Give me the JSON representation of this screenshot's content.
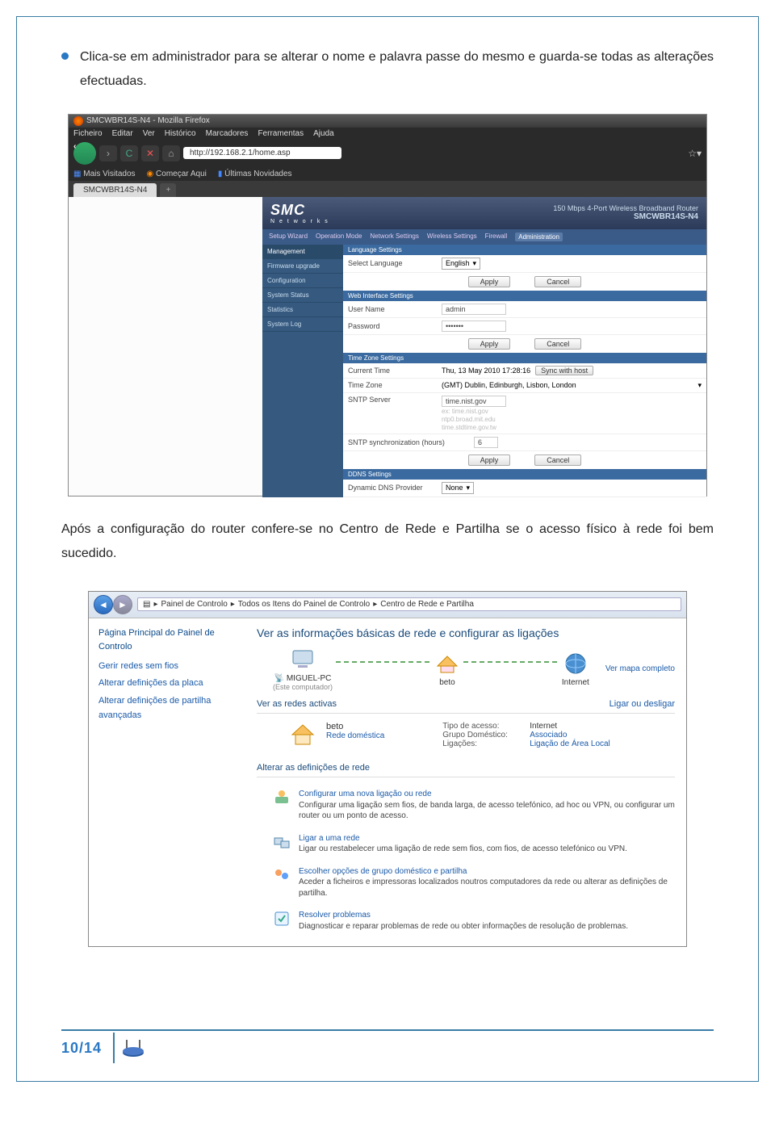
{
  "para1": "Clica-se em administrador para se alterar o nome e palavra passe do mesmo e guarda-se todas as alterações efectuadas.",
  "para2": "Após a configuração do router confere-se no Centro de Rede e Partilha se o acesso físico à rede foi bem sucedido.",
  "page_number": "10/14",
  "firefox": {
    "title": "SMCWBR14S-N4 - Mozilla Firefox",
    "menu": [
      "Ficheiro",
      "Editar",
      "Ver",
      "Histórico",
      "Marcadores",
      "Ferramentas",
      "Ajuda"
    ],
    "url": "http://192.168.2.1/home.asp",
    "bookmarks": [
      "Mais Visitados",
      "Começar Aqui",
      "Últimas Novidades"
    ],
    "tab": "SMCWBR14S-N4"
  },
  "router": {
    "brand": "SMC",
    "brand_sub": "N e t w o r k s",
    "product_title": "150 Mbps 4-Port Wireless Broadband Router",
    "model": "SMCWBR14S-N4",
    "top_tabs": [
      "Setup Wizard",
      "Operation Mode",
      "Network Settings",
      "Wireless Settings",
      "Firewall",
      "Administration"
    ],
    "side": [
      "Management",
      "Firmware upgrade",
      "Configuration",
      "System Status",
      "Statistics",
      "System Log"
    ],
    "lang_hdr": "Language Settings",
    "lang_lbl": "Select Language",
    "lang_val": "English",
    "apply": "Apply",
    "cancel": "Cancel",
    "web_hdr": "Web Interface Settings",
    "user_lbl": "User Name",
    "user_val": "admin",
    "pass_lbl": "Password",
    "pass_val": "•••••••",
    "tz_hdr": "Time Zone Settings",
    "ct_lbl": "Current Time",
    "ct_val": "Thu, 13 May 2010 17:28:16",
    "sync_btn": "Sync with host",
    "tz_lbl": "Time Zone",
    "tz_val": "(GMT) Dublin, Edinburgh, Lisbon, London",
    "sntp_lbl": "SNTP Server",
    "sntp_val": "time.nist.gov",
    "sntp_ex1": "ex: time.nist.gov",
    "sntp_ex2": "ntp0.broad.mit.edu",
    "sntp_ex3": "time.stdtime.gov.tw",
    "sync_int_lbl": "SNTP synchronization (hours)",
    "sync_int_val": "6",
    "ddns_hdr": "DDNS Settings",
    "ddns_lbl": "Dynamic DNS Provider",
    "ddns_val": "None"
  },
  "win": {
    "crumbs": [
      "Painel de Controlo",
      "Todos os Itens do Painel de Controlo",
      "Centro de Rede e Partilha"
    ],
    "side_hdr": "Página Principal do Painel de Controlo",
    "side_links": [
      "Gerir redes sem fios",
      "Alterar definições da placa",
      "Alterar definições de partilha avançadas"
    ],
    "h1": "Ver as informações básicas de rede e configurar as ligações",
    "map_link": "Ver mapa completo",
    "node1": "MIGUEL-PC",
    "node1_sub": "(Este computador)",
    "node2": "beto",
    "node3": "Internet",
    "active_hdr": "Ver as redes activas",
    "ligar": "Ligar ou desligar",
    "net_name": "beto",
    "net_type": "Rede doméstica",
    "p1_l": "Tipo de acesso:",
    "p1_v": "Internet",
    "p2_l": "Grupo Doméstico:",
    "p2_v": "Associado",
    "p3_l": "Ligações:",
    "p3_v": "Ligação de Área Local",
    "change_hdr": "Alterar as definições de rede",
    "it1_t": "Configurar uma nova ligação ou rede",
    "it1_d": "Configurar uma ligação sem fios, de banda larga, de acesso telefónico, ad hoc ou VPN, ou configurar um router ou um ponto de acesso.",
    "it2_t": "Ligar a uma rede",
    "it2_d": "Ligar ou restabelecer uma ligação de rede sem fios, com fios, de acesso telefónico ou VPN.",
    "it3_t": "Escolher opções de grupo doméstico e partilha",
    "it3_d": "Aceder a ficheiros e impressoras localizados noutros computadores da rede ou alterar as definições de partilha.",
    "it4_t": "Resolver problemas",
    "it4_d": "Diagnosticar e reparar problemas de rede ou obter informações de resolução de problemas."
  }
}
